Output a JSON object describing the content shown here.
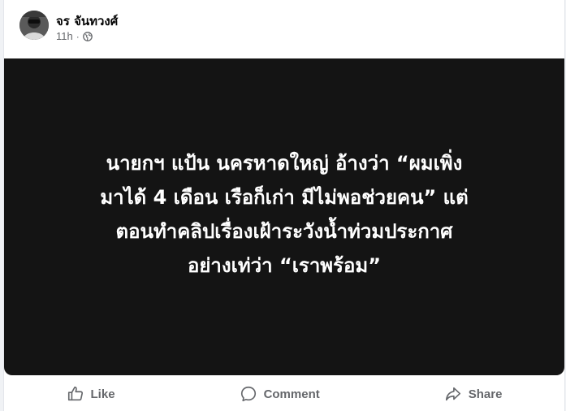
{
  "post": {
    "author": "จร จันทวงศ์",
    "time": "11h",
    "separator": "·",
    "privacy_icon": "globe-icon",
    "image_text": "นายกฯ แป้น นครหาดใหญ่ อ้างว่า “ผมเพิ่ง\nมาได้ 4 เดือน เรือก็เก่า มีไม่พอช่วยคน” แต่\nตอนทำคลิปเรื่องเฝ้าระวังน้ำท่วมประกาศ\nอย่างเท่ว่า “เราพร้อม”"
  },
  "actions": {
    "like": "Like",
    "comment": "Comment",
    "share": "Share"
  },
  "colors": {
    "image_background": "#141414",
    "muted_text": "#65676b"
  }
}
